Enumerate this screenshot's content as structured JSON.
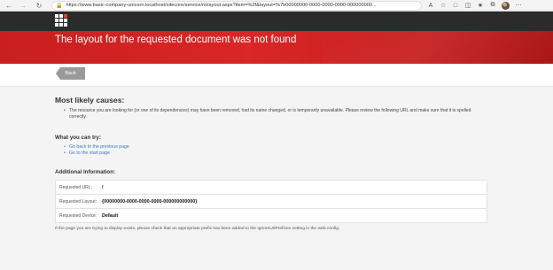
{
  "browser": {
    "url": "https://www.basic-company-unicorn.localhost/sitecore/service/nolayout.aspx?item=%2f&layout=%7b00000000-0000-0000-0000-000000000...",
    "icons": [
      "back-icon",
      "forward-icon",
      "reload-icon",
      "lock-icon",
      "read-aloud-icon",
      "favorite-icon",
      "extensions-icon",
      "split-screen-icon",
      "favorites-icon",
      "collections-icon",
      "profile-avatar"
    ]
  },
  "banner": {
    "title": "The layout for the requested document was not found"
  },
  "back_button": {
    "label": "Back"
  },
  "causes": {
    "heading": "Most likely causes:",
    "items": [
      "The resource you are looking for (or one of its dependencies) may have been removed, had its name changed, or is temporarily unavailable. Please review the following URL and make sure that it is spelled correctly."
    ]
  },
  "try": {
    "heading": "What you can try:",
    "links": [
      "Go back to the previous page",
      "Go to the start page"
    ]
  },
  "info": {
    "heading": "Additional Information:",
    "rows": [
      {
        "key": "Requested URL:",
        "value": "/"
      },
      {
        "key": "Requested Layout:",
        "value": "{00000000-0000-0000-0000-000000000000}"
      },
      {
        "key": "Requested Device:",
        "value": "Default"
      }
    ]
  },
  "footer_note": "If the page you are trying to display exists, please check that an appropriate prefix has been added to the IgnoreUrlPrefixes setting in the web.config.",
  "colors": {
    "banner_red": "#d92626",
    "header_dark": "#2b2b2b",
    "link_blue": "#3b7bc4",
    "back_button_gray": "#9a9a9a"
  }
}
